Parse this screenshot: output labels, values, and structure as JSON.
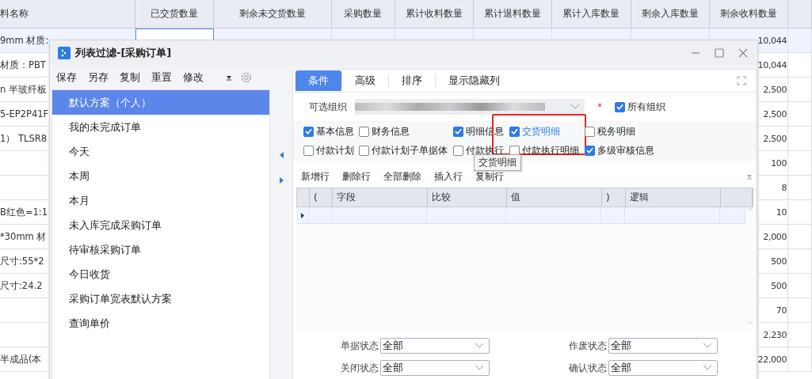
{
  "background_table": {
    "columns": [
      "料名称",
      "已交货数量",
      "剩余未交货数量",
      "采购数量",
      "累计收料数量",
      "累计退料数量",
      "累计入库数量",
      "剩余入库数量",
      "剩余收料数量"
    ],
    "rows": [
      {
        "name": "9mm  材质:",
        "remaining": "10,044",
        "selected": true
      },
      {
        "name": "材质：PBT",
        "remaining": "10,044",
        "selected": false
      },
      {
        "name": "n 半玻纤板",
        "remaining": "2,500",
        "selected": false
      },
      {
        "name": "5-EP2P41F",
        "remaining": "2,500",
        "selected": false
      },
      {
        "name": "1）  TLSR8",
        "remaining": "2,500",
        "selected": false
      },
      {
        "name": "",
        "remaining": "100",
        "selected": false
      },
      {
        "name": "",
        "remaining": "8",
        "selected": false
      },
      {
        "name": "B红色=1:1",
        "remaining": "10",
        "selected": false
      },
      {
        "name": "*30mm 材",
        "remaining": "2,000",
        "selected": false
      },
      {
        "name": "尺寸:55*2",
        "remaining": "500",
        "selected": false
      },
      {
        "name": "尺寸:24.2",
        "remaining": "500",
        "selected": false
      },
      {
        "name": "",
        "remaining": "70",
        "selected": false
      },
      {
        "name": "",
        "remaining": "2,230",
        "selected": false
      },
      {
        "name": "半成品(本",
        "remaining": "22,000",
        "selected": false
      }
    ]
  },
  "dialog": {
    "title": "列表过滤-[采购订单]",
    "toolbar": [
      "保存",
      "另存",
      "复制",
      "重置",
      "修改"
    ],
    "schemes": [
      {
        "label": "默认方案（个人）",
        "selected": true
      },
      {
        "label": "我的未完成订单",
        "selected": false
      },
      {
        "label": "今天",
        "selected": false
      },
      {
        "label": "本周",
        "selected": false
      },
      {
        "label": "本月",
        "selected": false
      },
      {
        "label": "未入库完成采购订单",
        "selected": false
      },
      {
        "label": "待审核采购订单",
        "selected": false
      },
      {
        "label": "今日收货",
        "selected": false
      },
      {
        "label": "采购订单宽表默认方案",
        "selected": false
      },
      {
        "label": "查询单价",
        "selected": false
      }
    ],
    "tabs": [
      {
        "label": "条件",
        "selected": true
      },
      {
        "label": "高级",
        "selected": false
      },
      {
        "label": "排序",
        "selected": false
      },
      {
        "label": "显示隐藏列",
        "selected": false
      }
    ],
    "org_label": "可选组织",
    "required_mark": "*",
    "all_orgs": {
      "label": "所有组织",
      "checked": true
    },
    "options": [
      {
        "label": "基本信息",
        "checked": true,
        "highlighted": false
      },
      {
        "label": "财务信息",
        "checked": false,
        "highlighted": false
      },
      {
        "label": "明细信息",
        "checked": true,
        "highlighted": false
      },
      {
        "label": "交货明细",
        "checked": true,
        "highlighted": true
      },
      {
        "label": "税务明细",
        "checked": false,
        "highlighted": false
      },
      {
        "label": "付款计划",
        "checked": false,
        "highlighted": false
      },
      {
        "label": "付款计划子单据体",
        "checked": false,
        "highlighted": false
      },
      {
        "label": "付款执行",
        "checked": false,
        "highlighted": false
      },
      {
        "label": "付款执行明细",
        "checked": false,
        "highlighted": false
      },
      {
        "label": "多级审核信息",
        "checked": true,
        "highlighted": false
      }
    ],
    "tooltip": "交货明细",
    "grid_actions": [
      "新增行",
      "删除行",
      "全部删除",
      "插入行",
      "复制行"
    ],
    "grid_columns": [
      "(",
      "字段",
      "比较",
      "值",
      ")",
      "逻辑"
    ],
    "status_fields": [
      {
        "label": "单据状态",
        "value": "全部"
      },
      {
        "label": "作废状态",
        "value": "全部"
      },
      {
        "label": "关闭状态",
        "value": "全部"
      },
      {
        "label": "确认状态",
        "value": "全部"
      }
    ]
  }
}
